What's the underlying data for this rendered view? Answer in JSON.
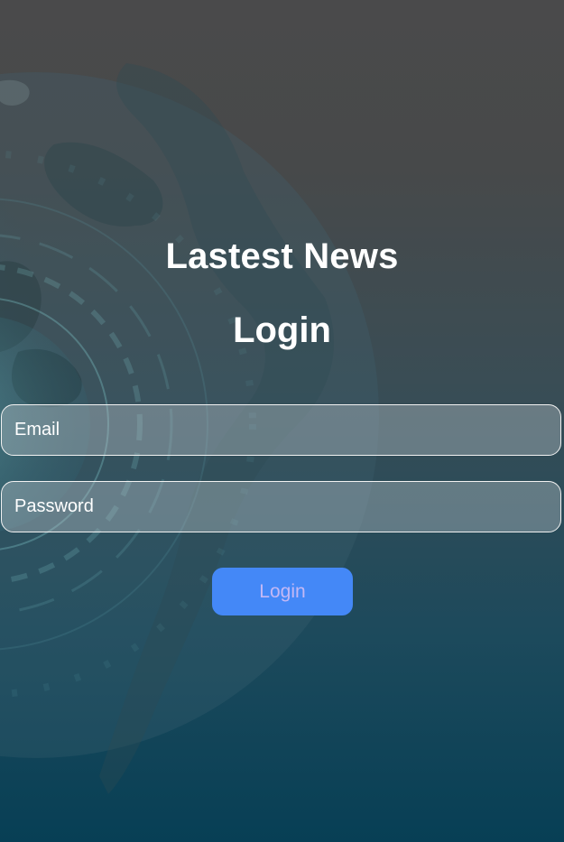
{
  "app": {
    "title": "Lastest News"
  },
  "login": {
    "heading": "Login",
    "email_placeholder": "Email",
    "password_placeholder": "Password",
    "button_label": "Login"
  },
  "colors": {
    "button_background": "#4488f7",
    "button_text": "#c3b8f5",
    "background_top": "#4a4a4b",
    "background_bottom": "#073f55"
  },
  "icons": {
    "background": "globe-icon"
  }
}
